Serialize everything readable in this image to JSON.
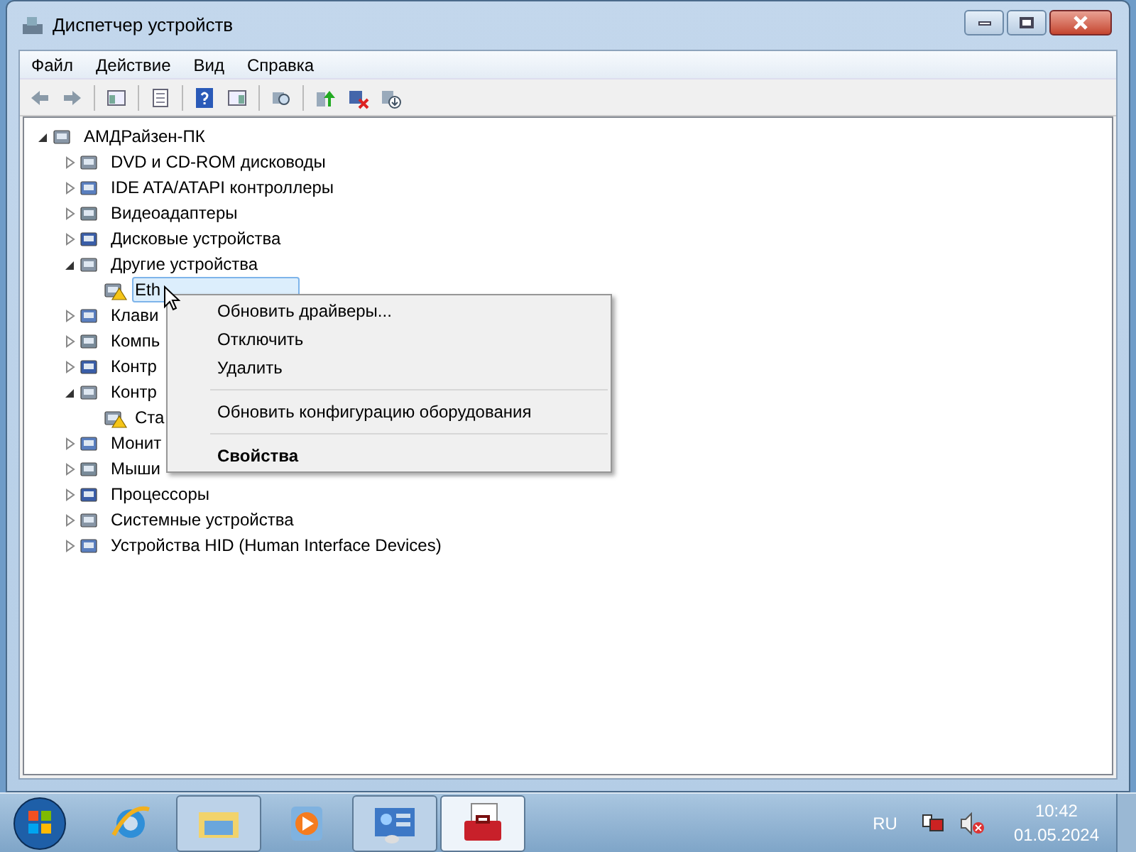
{
  "window": {
    "title": "Диспетчер устройств"
  },
  "menu": [
    "Файл",
    "Действие",
    "Вид",
    "Справка"
  ],
  "tree": {
    "label": "АМДРайзен-ПК",
    "expanded": true,
    "children": [
      {
        "label": "DVD и CD-ROM дисководы",
        "expanded": false
      },
      {
        "label": "IDE ATA/ATAPI контроллеры",
        "expanded": false
      },
      {
        "label": "Видеоадаптеры",
        "expanded": false
      },
      {
        "label": "Дисковые устройства",
        "expanded": false
      },
      {
        "label": "Другие устройства",
        "expanded": true,
        "children": [
          {
            "label": "Eth",
            "warning": true,
            "selected": true
          }
        ]
      },
      {
        "label": "Клави",
        "expanded": false
      },
      {
        "label": "Компь",
        "expanded": false
      },
      {
        "label": "Контр",
        "expanded": false
      },
      {
        "label": "Контр",
        "expanded": true,
        "children": [
          {
            "label": "Ста",
            "warning": true,
            "selected": false
          }
        ]
      },
      {
        "label": "Монит",
        "expanded": false
      },
      {
        "label": "Мыши",
        "expanded": false
      },
      {
        "label": "Процессоры",
        "expanded": false
      },
      {
        "label": "Системные устройства",
        "expanded": false
      },
      {
        "label": "Устройства HID (Human Interface Devices)",
        "expanded": false
      }
    ]
  },
  "context_menu": [
    {
      "kind": "item",
      "label": "Обновить драйверы...",
      "default": false
    },
    {
      "kind": "item",
      "label": "Отключить",
      "default": false
    },
    {
      "kind": "item",
      "label": "Удалить",
      "default": false
    },
    {
      "kind": "separator"
    },
    {
      "kind": "item",
      "label": "Обновить конфигурацию оборудования",
      "default": false
    },
    {
      "kind": "separator"
    },
    {
      "kind": "item",
      "label": "Свойства",
      "default": true
    }
  ],
  "taskbar": [
    {
      "running": false,
      "selected": false
    },
    {
      "running": true,
      "selected": false
    },
    {
      "running": false,
      "selected": false
    },
    {
      "running": true,
      "selected": false
    },
    {
      "running": true,
      "selected": true
    }
  ],
  "tray": {
    "language": "RU",
    "time": "10:42",
    "date": "01.05.2024"
  }
}
